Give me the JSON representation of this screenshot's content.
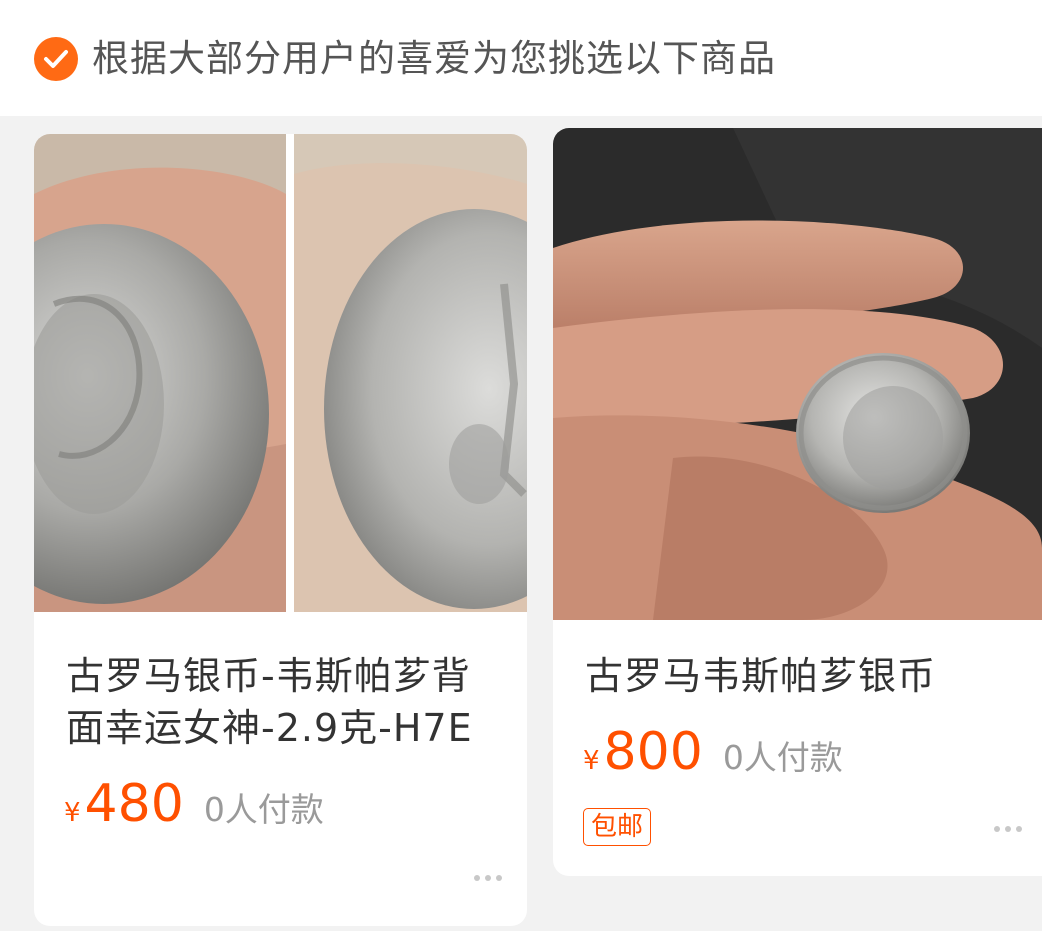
{
  "header": {
    "icon": "check-circle-icon",
    "text": "根据大部分用户的喜爱为您挑选以下商品",
    "accent": "#ff6a14"
  },
  "products": [
    {
      "image": "ancient-roman-silver-coin-front-and-back-photo",
      "title": "古罗马银币-韦斯帕芗背面幸运女神-2.9克-H7E",
      "currency": "¥",
      "price": "480",
      "paid_count": "0人付款",
      "more_icon": "more-dots-icon"
    },
    {
      "image": "roman-silver-coin-held-in-fingers-photo",
      "title": "古罗马韦斯帕芗银币",
      "currency": "¥",
      "price": "800",
      "paid_count": "0人付款",
      "tag": "包邮",
      "more_icon": "more-dots-icon"
    }
  ],
  "colors": {
    "price": "#ff5000",
    "muted": "#9a9a9a",
    "background": "#f2f2f2"
  }
}
